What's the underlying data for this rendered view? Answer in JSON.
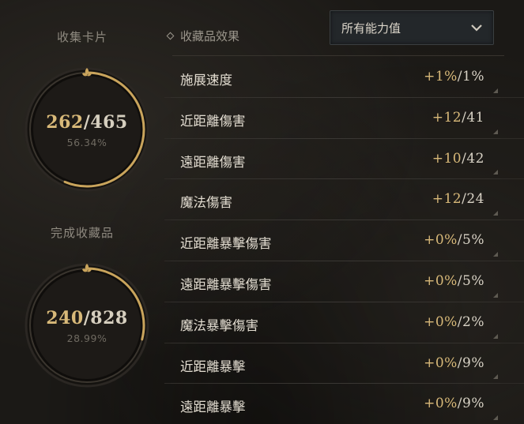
{
  "cards": {
    "label": "收集卡片",
    "current": "262",
    "total": "465",
    "percent_text": "56.34%",
    "progress": 0.5634
  },
  "collections": {
    "label": "完成收藏品",
    "current": "240",
    "total": "828",
    "percent_text": "28.99%",
    "progress": 0.2899
  },
  "effects": {
    "header": "收藏品效果",
    "filter": "所有能力值",
    "stats": [
      {
        "name": "施展速度",
        "bonus": "+1%",
        "max": "/1%"
      },
      {
        "name": "近距離傷害",
        "bonus": "+12",
        "max": "/41"
      },
      {
        "name": "遠距離傷害",
        "bonus": "+10",
        "max": "/42"
      },
      {
        "name": "魔法傷害",
        "bonus": "+12",
        "max": "/24"
      },
      {
        "name": "近距離暴擊傷害",
        "bonus": "+0%",
        "max": "/5%"
      },
      {
        "name": "遠距離暴擊傷害",
        "bonus": "+0%",
        "max": "/5%"
      },
      {
        "name": "魔法暴擊傷害",
        "bonus": "+0%",
        "max": "/2%"
      },
      {
        "name": "近距離暴擊",
        "bonus": "+0%",
        "max": "/9%"
      },
      {
        "name": "遠距離暴擊",
        "bonus": "+0%",
        "max": "/9%"
      }
    ]
  },
  "colors": {
    "gold": "#d8b979",
    "ring_track": "#2a2622",
    "ring_fill": "#c9a45c"
  }
}
